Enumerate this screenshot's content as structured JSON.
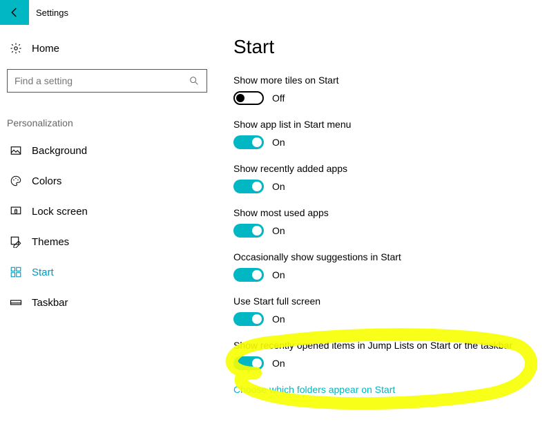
{
  "header": {
    "title": "Settings"
  },
  "sidebar": {
    "home_label": "Home",
    "search_placeholder": "Find a setting",
    "section_label": "Personalization",
    "items": [
      {
        "label": "Background",
        "active": false
      },
      {
        "label": "Colors",
        "active": false
      },
      {
        "label": "Lock screen",
        "active": false
      },
      {
        "label": "Themes",
        "active": false
      },
      {
        "label": "Start",
        "active": true
      },
      {
        "label": "Taskbar",
        "active": false
      }
    ]
  },
  "page": {
    "title": "Start",
    "state_on": "On",
    "state_off": "Off",
    "settings": [
      {
        "label": "Show more tiles on Start",
        "on": false
      },
      {
        "label": "Show app list in Start menu",
        "on": true
      },
      {
        "label": "Show recently added apps",
        "on": true
      },
      {
        "label": "Show most used apps",
        "on": true
      },
      {
        "label": "Occasionally show suggestions in Start",
        "on": true
      },
      {
        "label": "Use Start full screen",
        "on": true
      },
      {
        "label": "Show recently opened items in Jump Lists on Start or the taskbar",
        "on": true
      }
    ],
    "link": "Choose which folders appear on Start"
  }
}
